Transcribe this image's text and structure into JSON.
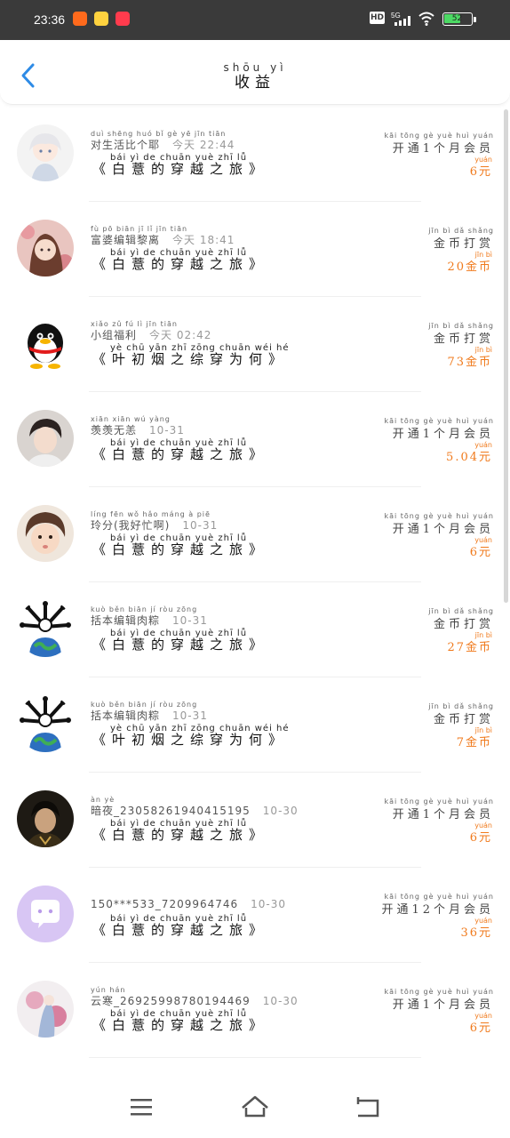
{
  "status_bar": {
    "time": "23:36",
    "network": "5G",
    "hd": "HD",
    "battery": "52",
    "app_icons": [
      {
        "name": "kuaishou-icon",
        "color": "#ff6a1c"
      },
      {
        "name": "sunflower-app-icon",
        "color": "#ffd23f"
      },
      {
        "name": "dianping-icon",
        "color": "#ff3b4d"
      }
    ]
  },
  "header": {
    "title_pinyin": "shōu yì",
    "title": "收益"
  },
  "records": [
    {
      "user_pinyin": "duì shēng huó bǐ gè yē    jīn tiān",
      "user": "对生活比个耶",
      "time": "今天 22:44",
      "book_pinyin": "bái yì de chuān yuè zhī lǚ",
      "book": "《白薏的穿越之旅》",
      "type_pinyin": "kāi tōng gè yuè huì yuán",
      "type": "开通1个月会员",
      "amount_pinyin": "yuán",
      "amount": "6元",
      "avatar": "anime-girl-white"
    },
    {
      "user_pinyin": "fù pō biān jī lǐ    jīn tiān",
      "user": "富婆编辑黎离",
      "time": "今天 18:41",
      "book_pinyin": "bái yì de chuān yuè zhī lǚ",
      "book": "《白薏的穿越之旅》",
      "type_pinyin": "jīn bì dǎ shǎng",
      "type": "金币打赏",
      "amount_pinyin": "jīn bì",
      "amount": "20金币",
      "avatar": "anime-girl-flowers"
    },
    {
      "user_pinyin": "xiǎo zǔ fú lì    jīn tiān",
      "user": "小组福利",
      "time": "今天 02:42",
      "book_pinyin": "yè chū yān zhī zōng chuān wéi hé",
      "book": "《叶初烟之综穿为何》",
      "type_pinyin": "jīn bì dǎ shǎng",
      "type": "金币打赏",
      "amount_pinyin": "jīn bì",
      "amount": "73金币",
      "avatar": "qq-penguin"
    },
    {
      "user_pinyin": "xiān xiān wú yàng",
      "user": "羡羡无恙",
      "time": "10-31",
      "book_pinyin": "bái yì de chuān yuè zhī lǚ",
      "book": "《白薏的穿越之旅》",
      "type_pinyin": "kāi tōng gè yuè huì yuán",
      "type": "开通1个月会员",
      "amount_pinyin": "yuán",
      "amount": "5.04元",
      "avatar": "young-man"
    },
    {
      "user_pinyin": "líng fēn wǒ hǎo máng à piē",
      "user": "玲分(我好忙啊)",
      "time": "10-31",
      "book_pinyin": "bái yì de chuān yuè zhī lǚ",
      "book": "《白薏的穿越之旅》",
      "type_pinyin": "kāi tōng gè yuè huì yuán",
      "type": "开通1个月会员",
      "amount_pinyin": "yuán",
      "amount": "6元",
      "avatar": "child"
    },
    {
      "user_pinyin": "kuò běn biān jí ròu zōng",
      "user": "括本编辑肉粽",
      "time": "10-31",
      "book_pinyin": "bái yì de chuān yuè zhī lǚ",
      "book": "《白薏的穿越之旅》",
      "type_pinyin": "jīn bì dǎ shǎng",
      "type": "金币打赏",
      "amount_pinyin": "jīn bì",
      "amount": "27金币",
      "avatar": "bones-globe"
    },
    {
      "user_pinyin": "kuò běn biān jí ròu zōng",
      "user": "括本编辑肉粽",
      "time": "10-31",
      "book_pinyin": "yè chū yān zhī zōng chuān wéi hé",
      "book": "《叶初烟之综穿为何》",
      "type_pinyin": "jīn bì dǎ shǎng",
      "type": "金币打赏",
      "amount_pinyin": "jīn bì",
      "amount": "7金币",
      "avatar": "bones-globe"
    },
    {
      "user_pinyin": "àn yè",
      "user": "暗夜_2305826194041519​5",
      "time": "10-30",
      "book_pinyin": "bái yì de chuān yuè zhī lǚ",
      "book": "《白薏的穿越之旅》",
      "type_pinyin": "kāi tōng gè yuè huì yuán",
      "type": "开通1个月会员",
      "amount_pinyin": "yuán",
      "amount": "6元",
      "avatar": "dark-man"
    },
    {
      "user_pinyin": "",
      "user": "150***533_7209964746",
      "time": "10-30",
      "book_pinyin": "bái yì de chuān yuè zhī lǚ",
      "book": "《白薏的穿越之旅》",
      "type_pinyin": "kāi tōng gè yuè huì yuán",
      "type": "开通12个月会员",
      "amount_pinyin": "yuán",
      "amount": "36元",
      "avatar": "chat-bubble"
    },
    {
      "user_pinyin": "yún hán",
      "user": "云寒_26925998780194469",
      "time": "10-30",
      "book_pinyin": "bái yì de chuān yuè zhī lǚ",
      "book": "《白薏的穿越之旅》",
      "type_pinyin": "kāi tōng gè yuè huì yuán",
      "type": "开通1个月会员",
      "amount_pinyin": "yuán",
      "amount": "6元",
      "avatar": "ink-painting"
    }
  ],
  "colors": {
    "accent": "#2e8be6",
    "amount": "#f07a1c"
  }
}
